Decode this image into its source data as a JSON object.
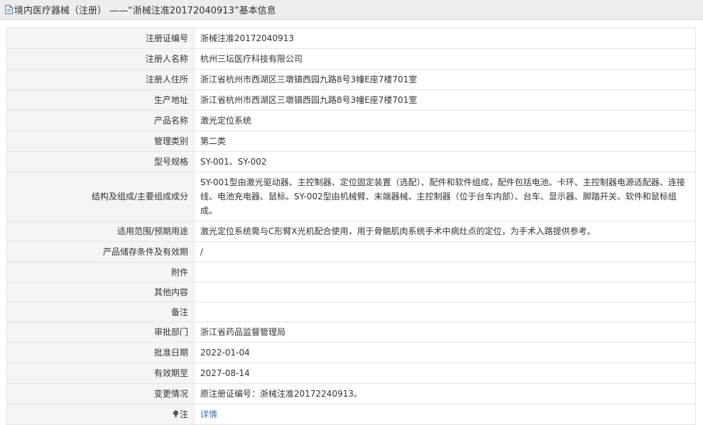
{
  "header": {
    "title": "境内医疗器械（注册） ——“浙械注准20172040913”基本信息"
  },
  "rows": [
    {
      "label": "注册证编号",
      "value": "浙械注准20172040913"
    },
    {
      "label": "注册人名称",
      "value": "杭州三坛医疗科技有限公司"
    },
    {
      "label": "注册人住所",
      "value": "浙江省杭州市西湖区三墩镇西园九路8号3幢E座7楼701室"
    },
    {
      "label": "生产地址",
      "value": "浙江省杭州市西湖区三墩镇西园九路8号3幢E座7楼701室"
    },
    {
      "label": "产品名称",
      "value": "激光定位系统"
    },
    {
      "label": "管理类别",
      "value": "第二类"
    },
    {
      "label": "型号规格",
      "value": "SY-001、SY-002"
    },
    {
      "label": "结构及组成/主要组成成分",
      "value": "SY-001型由激光驱动器、主控制器、定位固定装置（选配）、配件和软件组成，配件包括电池、卡环、主控制器电源适配器、连接线、电池充电器、鼠标。SY-002型由机械臂、末端器械、主控制器（位于台车内部）、台车、显示器、脚踏开关、软件和鼠标组成。"
    },
    {
      "label": "适用范围/预期用途",
      "value": "激光定位系统需与C形臂X光机配合使用，用于骨骼肌肉系统手术中病灶点的定位，为手术入路提供参考。"
    },
    {
      "label": "产品储存条件及有效期",
      "value": "/"
    },
    {
      "label": "附件",
      "value": ""
    },
    {
      "label": "其他内容",
      "value": ""
    },
    {
      "label": "备注",
      "value": ""
    },
    {
      "label": "审批部门",
      "value": "浙江省药品监督管理局"
    },
    {
      "label": "批准日期",
      "value": "2022-01-04"
    },
    {
      "label": "有效期至",
      "value": "2027-08-14"
    },
    {
      "label": "变更情况",
      "value": "原注册证编号：浙械注准20172240913。"
    }
  ],
  "note": {
    "label": "注",
    "icon": "lightbulb-icon",
    "link_text": "详情",
    "link_color": "#3a6fb5"
  }
}
